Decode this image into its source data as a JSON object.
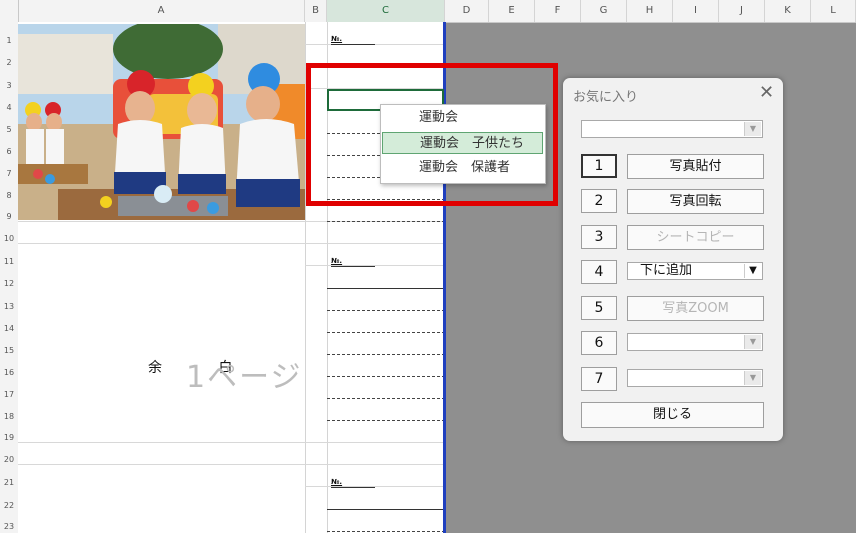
{
  "sheet": {
    "columns": [
      "A",
      "B",
      "C",
      "D",
      "E",
      "F",
      "G",
      "H",
      "I",
      "J",
      "K",
      "L"
    ],
    "rows": [
      "1",
      "2",
      "3",
      "4",
      "5",
      "6",
      "7",
      "8",
      "9",
      "10",
      "11",
      "12",
      "13",
      "14",
      "15",
      "16",
      "17",
      "18",
      "19",
      "20",
      "21",
      "22",
      "23"
    ],
    "no_label": "№.",
    "margin_text": "余 白",
    "page_watermark": "1ページ"
  },
  "dropdown": {
    "items": [
      "運動会",
      "運動会　子供たち",
      "運動会　保護者"
    ],
    "highlighted_index": 1
  },
  "dialog": {
    "title": "お気に入り",
    "close_icon": "close-icon",
    "top_combo_value": "",
    "buttons": [
      {
        "num": "1",
        "label": "写真貼付",
        "enabled": true
      },
      {
        "num": "2",
        "label": "写真回転",
        "enabled": true
      },
      {
        "num": "3",
        "label": "シートコピー",
        "enabled": false
      },
      {
        "num": "4",
        "label": "下に追加",
        "type": "combo"
      },
      {
        "num": "5",
        "label": "写真ZOOM",
        "enabled": false
      },
      {
        "num": "6",
        "label": "",
        "type": "combo"
      },
      {
        "num": "7",
        "label": "",
        "type": "combo"
      }
    ],
    "close_label": "閉じる"
  },
  "colors": {
    "highlight_frame": "#e00000",
    "page_border": "#1f3fbf",
    "selection": "#1e6b3a"
  }
}
